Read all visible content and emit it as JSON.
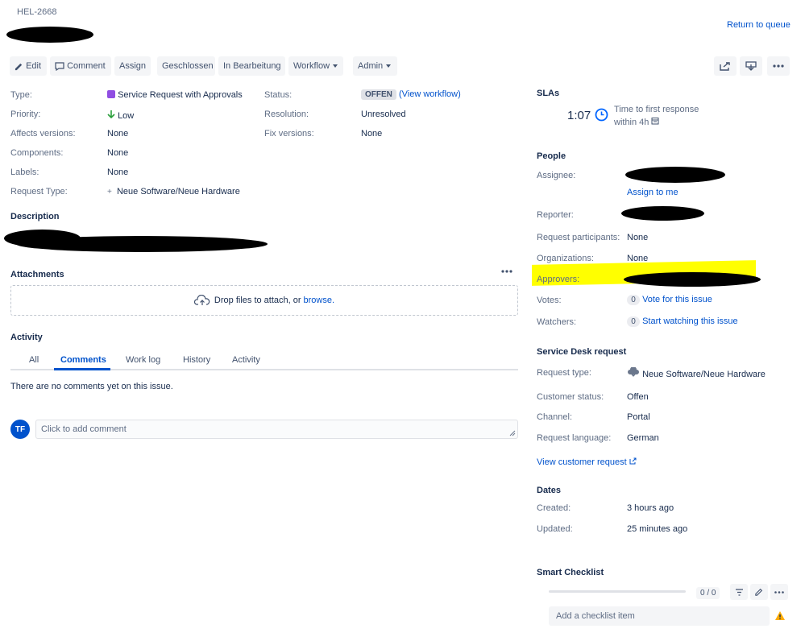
{
  "issue": {
    "key": "HEL-2668"
  },
  "return_link": "Return to queue",
  "toolbar": {
    "edit": "Edit",
    "comment": "Comment",
    "assign": "Assign",
    "geschlossen": "Geschlossen",
    "in_bearbeitung": "In Bearbeitung",
    "workflow": "Workflow",
    "admin": "Admin"
  },
  "fields": {
    "type_label": "Type:",
    "type_value": "Service Request with Approvals",
    "priority_label": "Priority:",
    "priority_value": "Low",
    "affects_label": "Affects versions:",
    "affects_value": "None",
    "components_label": "Components:",
    "components_value": "None",
    "labels_label": "Labels:",
    "labels_value": "None",
    "reqtype_label": "Request Type:",
    "reqtype_value": "Neue Software/Neue Hardware",
    "status_label": "Status:",
    "status_value": "OFFEN",
    "view_workflow": "(View workflow)",
    "resolution_label": "Resolution:",
    "resolution_value": "Unresolved",
    "fix_label": "Fix versions:",
    "fix_value": "None"
  },
  "description": {
    "title": "Description"
  },
  "attachments": {
    "title": "Attachments",
    "drop_text": "Drop files to attach, or",
    "browse": "browse."
  },
  "activity": {
    "title": "Activity",
    "tabs": [
      "All",
      "Comments",
      "Work log",
      "History",
      "Activity"
    ],
    "active_tab": "Comments",
    "empty": "There are no comments yet on this issue.",
    "avatar": "TF",
    "comment_placeholder": "Click to add comment"
  },
  "slas": {
    "title": "SLAs",
    "time": "1:07",
    "name": "Time to first response",
    "goal": "within 4h"
  },
  "people": {
    "title": "People",
    "assignee_label": "Assignee:",
    "assign_to_me": "Assign to me",
    "reporter_label": "Reporter:",
    "participants_label": "Request participants:",
    "participants_value": "None",
    "organizations_label": "Organizations:",
    "organizations_value": "None",
    "approvers_label": "Approvers:",
    "votes_label": "Votes:",
    "votes_count": "0",
    "vote_link": "Vote for this issue",
    "watchers_label": "Watchers:",
    "watchers_count": "0",
    "watch_link": "Start watching this issue"
  },
  "service_desk": {
    "title": "Service Desk request",
    "request_type_label": "Request type:",
    "request_type_value": "Neue Software/Neue Hardware",
    "customer_status_label": "Customer status:",
    "customer_status_value": "Offen",
    "channel_label": "Channel:",
    "channel_value": "Portal",
    "language_label": "Request language:",
    "language_value": "German",
    "view_customer_request": "View customer request"
  },
  "dates": {
    "title": "Dates",
    "created_label": "Created:",
    "created_value": "3 hours ago",
    "updated_label": "Updated:",
    "updated_value": "25 minutes ago"
  },
  "smart_checklist": {
    "title": "Smart Checklist",
    "progress": "0 / 0",
    "progress_fraction": 0,
    "add_placeholder": "Add a checklist item"
  },
  "colors": {
    "link": "#0052cc",
    "highlight": "#ffff00",
    "issue_type": "#904ee2",
    "priority_low": "#2a9e3b",
    "avatar": "#0052cc",
    "warning": "#ffab00"
  }
}
